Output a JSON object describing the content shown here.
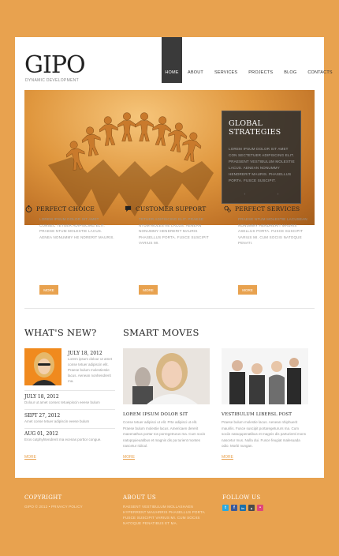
{
  "header": {
    "logo": "GIPO",
    "tagline": "DYNAMIC DEVELOPMENT",
    "nav": [
      "HOME",
      "ABOUT",
      "SERVICES",
      "PROJECTS",
      "BLOG",
      "CONTACTS"
    ]
  },
  "hero": {
    "title_line1": "GLOBAL",
    "title_line2": "STRATEGIES",
    "text": "LOREM IPSUM DOLOR SIT AMET CON SECTETUER ADIPISCING ELIT. PRAESENT VESTIBULUM MOLESTIE LACUS. AENEAN NONUMMY HENDRERIT MAURIS. PHASELLUS PORTA. FUSCE SUSCIPIT.",
    "prev_arrow": "‹",
    "next_arrow": "›"
  },
  "features": [
    {
      "title": "PERFECT CHOICE",
      "icon": "stopwatch-icon",
      "text": "LOREM IPSUM DOLOR SIT AMET CONSEC TETUER ADIPISCING ELIT. PRAESE NTUM MOLESTIE LACUS. AENEA NONUMMY HE NDRERIT MAURIS.",
      "button": "MORE"
    },
    {
      "title": "CUSTOMER SUPPORT",
      "icon": "speech-bubble-icon",
      "text": "TETUER ADIPISCING ELIT. PRAESE NTUM MOLESTIE LACUS. AENEAN NONUMMY HENDRERIT MAURIS PHASELLUS PORTA. FUSCE SUSCIPIT VARIUS MI.",
      "button": "MORE"
    },
    {
      "title": "PERFECT SERVICES",
      "icon": "gears-icon",
      "text": "PRAESE NTUM MOLESTIE LACUSEAN NONUMMY HENDRERIT MAURIS ASELLUS PORTA. FUSCE SUSCIPIT VARIUS MI. CUM SOCIIS NATOQUE PENATI.",
      "button": "MORE"
    }
  ],
  "whats_new": {
    "title": "WHAT'S NEW?",
    "first": {
      "date": "JULY 18, 2012",
      "text": "Lorem ipsum dolour ut amet conse tetuer adipiscin elit. Praese bulum molestiestie lacus. Aenean nonhendrerit ma."
    },
    "items": [
      {
        "date": "JULY 18, 2012",
        "text": "Dolour ut amet consec tetueipiscin eeese bulum"
      },
      {
        "date": "SEPT 27, 2012",
        "text": "Amet conse tetuer adipiscin eeese bulum"
      },
      {
        "date": "AUG 01, 2012",
        "text": "Eros cutphyhtendrerit ma ecenas porttor congue."
      }
    ],
    "more": "MORE"
  },
  "smart_moves": {
    "title": "SMART MOVES",
    "items": [
      {
        "title": "LOREM IPSUM DOLOR SIT",
        "text": "Conse tetuer adipisci ut elit. Prte adipisci ut elit. Praese bulum molestie lacus. Americaen dererit maeenathus portar tos porregetrurus ma. Cum socis natopquieuatibus et magnis dis pa turient montes nascetur ridicul.",
        "more": "MORE"
      },
      {
        "title": "VESTIBULUM LIBERSL POST",
        "text": "Praese bulum molestie lacus. Aenean nhiphuerit maurilis. Fusce suscipit portaregetururs ma. Cum sociis natoqupenatibus et magnis dis parturienti mons nascetur mus. Nulla dui. Fusce feugiat malesuada odio. Morbi nungan.",
        "more": "MORE"
      }
    ]
  },
  "footer": {
    "copyright_title": "COPYRIGHT",
    "copyright_text": "GIPO © 2012 • PRIVACY POLICY",
    "about_title": "ABOUT US",
    "about_text": "RAESENT VESTIBULUM MOLLASHAEN HYPERRENT MAUHRRIS PHASELLUS PORTA FUSCE SUSCIPIT VARIUS MI. CUM SOCIIS NATOQUE PENATIBUS ET MA.",
    "follow_title": "FOLLOW US",
    "social": [
      {
        "name": "twitter-icon",
        "glyph": "t",
        "color": "#2aa9e0"
      },
      {
        "name": "facebook-icon",
        "glyph": "f",
        "color": "#3b5998"
      },
      {
        "name": "linkedin-icon",
        "glyph": "in",
        "color": "#1c6fa8"
      },
      {
        "name": "picasa-icon",
        "glyph": "▲",
        "color": "#4a4a4a"
      },
      {
        "name": "flickr-icon",
        "glyph": "•",
        "color": "#e0457b"
      }
    ]
  },
  "colors": {
    "accent": "#e8a24f",
    "dark": "#3a3a3a"
  }
}
